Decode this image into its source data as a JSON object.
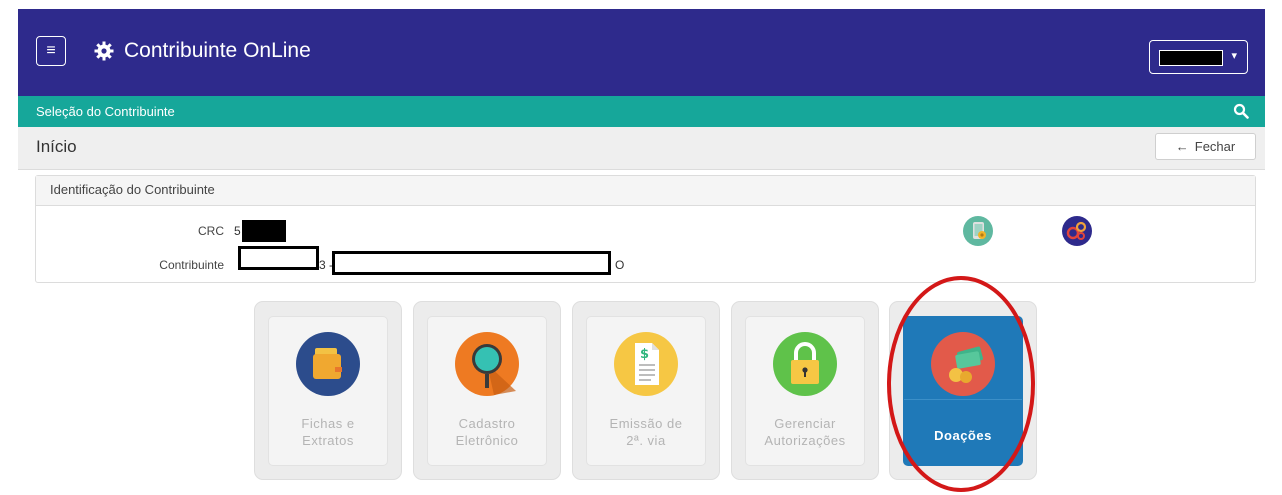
{
  "header": {
    "app_title": "Contribuinte OnLine",
    "menu_icon": "menu-icon",
    "settings_icon": "gear-icon",
    "user_dropdown_caret": "▾"
  },
  "subheader": {
    "label": "Seleção do Contribuinte",
    "search_icon": "search-icon"
  },
  "page": {
    "title": "Início",
    "close_label": "Fechar",
    "close_icon": "←"
  },
  "identification": {
    "heading": "Identificação do Contribuinte",
    "crc_label": "CRC",
    "crc_prefix": "5",
    "taxpayer_label": "Contribuinte",
    "taxpayer_mid": "3 -",
    "taxpayer_suffix": "O"
  },
  "tiles": [
    {
      "label": "Fichas e\nExtratos",
      "icon": "folder-icon"
    },
    {
      "label": "Cadastro\nEletrônico",
      "icon": "magnifier-icon"
    },
    {
      "label": "Emissão de\n2ª. via",
      "icon": "document-dollar-icon"
    },
    {
      "label": "Gerenciar\nAutorizações",
      "icon": "padlock-icon"
    },
    {
      "label": "Doações",
      "icon": "donation-money-icon",
      "active": true
    }
  ],
  "colors": {
    "header": "#2e2a8c",
    "subheader": "#16a79a",
    "active_tile": "#1f79b8",
    "highlight": "#d31818"
  }
}
